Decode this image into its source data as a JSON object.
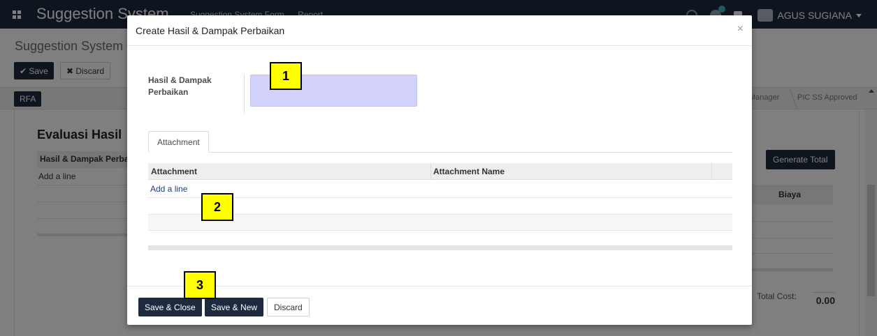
{
  "navbar": {
    "brand": "Suggestion System",
    "menu": [
      "Suggestion System Form",
      "Report"
    ],
    "user": "AGUS SUGIANA"
  },
  "page": {
    "breadcrumb": "Suggestion System Form",
    "save_label": "Save",
    "discard_label": "Discard",
    "status_button": "RFA",
    "stages": [
      "Manager",
      "PIC SS Approved"
    ],
    "section_title": "Evaluasi Hasil",
    "eval_column": "Hasil & Dampak Perbaikan",
    "eval_add_line": "Add a line",
    "generate_total_label": "Generate Total",
    "biaya_column": "Biaya",
    "total_cost_label": "Total Cost:",
    "total_cost_value": "0.00"
  },
  "modal": {
    "title": "Create Hasil & Dampak Perbaikan",
    "close_symbol": "×",
    "field_label": "Hasil & Dampak Perbaikan",
    "field_value": "",
    "tab_label": "Attachment",
    "columns": [
      "Attachment",
      "Attachment Name"
    ],
    "add_line": "Add a line",
    "buttons": {
      "save_close": "Save & Close",
      "save_new": "Save & New",
      "discard": "Discard"
    }
  },
  "callouts": [
    "1",
    "2",
    "3"
  ],
  "colors": {
    "navbar": "#1d2a3f",
    "primary_button": "#1d2a3f",
    "input_highlight": "#d2d2fb",
    "callout": "#ffff00"
  }
}
